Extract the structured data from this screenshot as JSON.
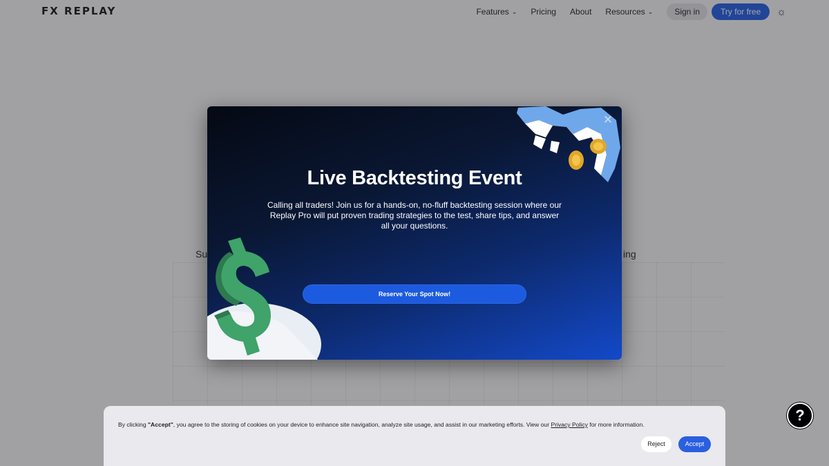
{
  "nav": {
    "logo": "FX REPLAY",
    "features": "Features",
    "pricing": "Pricing",
    "about": "About",
    "resources": "Resources",
    "signin": "Sign in",
    "try_free": "Try for free"
  },
  "background": {
    "left_fragment": "Su",
    "right_fragment": "ing"
  },
  "modal": {
    "title": "Live Backtesting Event",
    "description": "Calling all traders! Join us for a hands-on, no-fluff backtesting session where our Replay Pro will put proven trading strategies to the test, share tips, and answer all your questions.",
    "cta": "Reserve Your Spot Now!",
    "close_symbol": "✕"
  },
  "cookie": {
    "prefix": "By clicking ",
    "accept_quote": "\"Accept\"",
    "middle": ", you agree to the storing of cookies on your device to enhance site navigation, analyze site usage, and assist in our marketing efforts. View our ",
    "privacy_link": "Privacy Policy",
    "suffix": " for more information.",
    "reject": "Reject",
    "accept": "Accept"
  },
  "help": {
    "symbol": "?"
  },
  "colors": {
    "accent": "#2a63e6",
    "modal_dark": "#050913",
    "modal_blue": "#1349c9",
    "cookie_bg": "#e9e9ee"
  }
}
